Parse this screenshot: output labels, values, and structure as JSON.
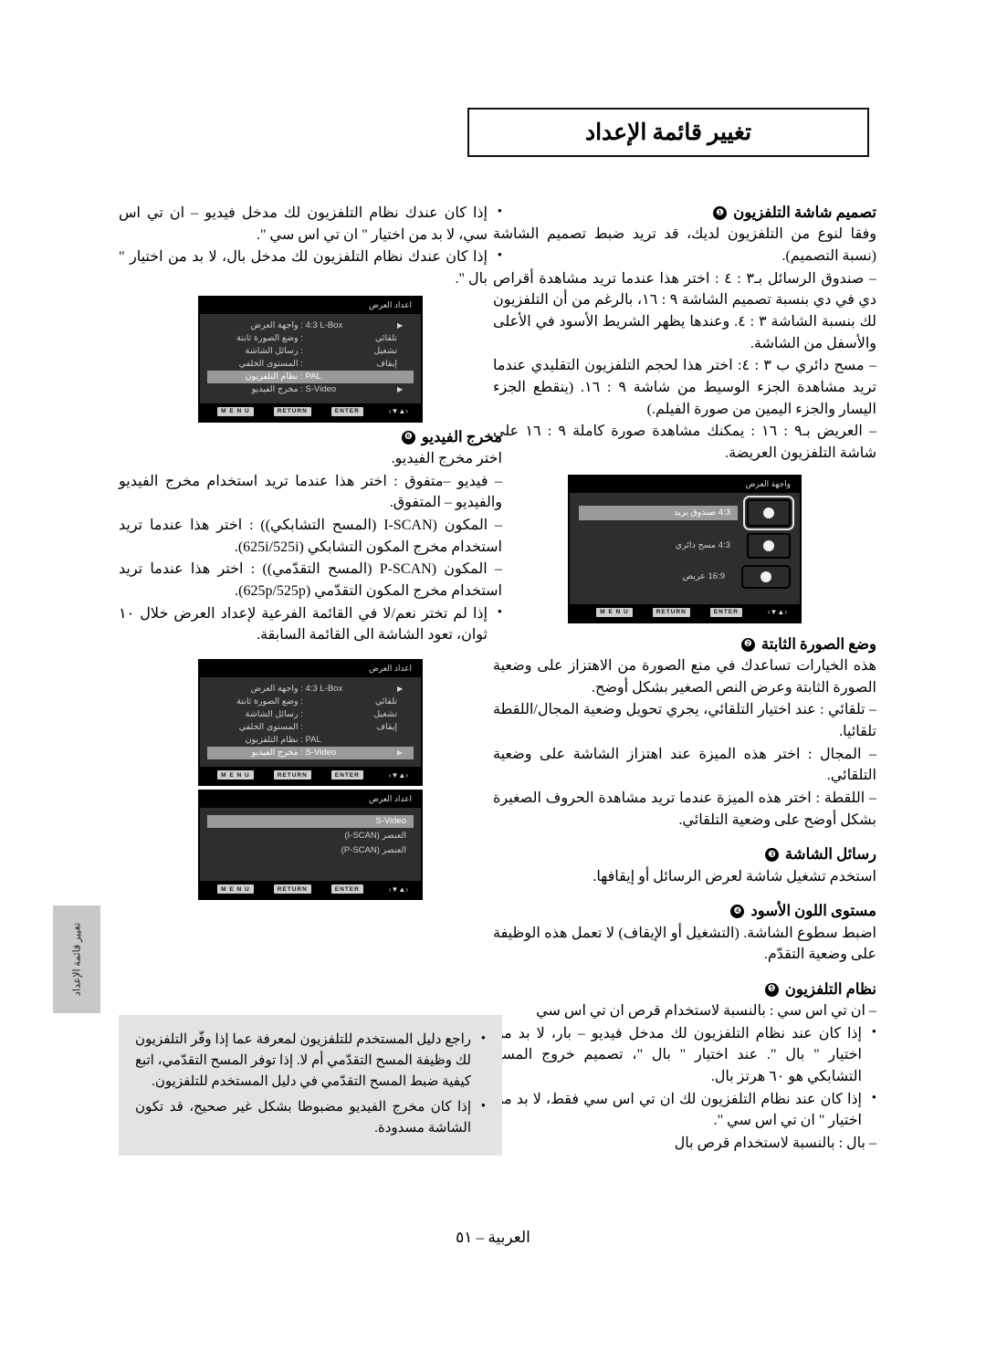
{
  "header": {
    "title": "تغيير قائمة الإعداد"
  },
  "footer": {
    "page_label": "العربية – ٥١"
  },
  "side_tab": {
    "label": "تغيير قائمة الإعداد"
  },
  "right_column": {
    "sections": [
      {
        "number": "❶",
        "title": "تصميم شاشة التلفزيون",
        "paragraphs": [
          "وفقا لنوع من التلفزيون لديك، قد تريد ضبط تصميم الشاشة (نسبة التصميم).",
          "– صندوق الرسائل بـ٣ : ٤ : اختر هذا عندما تريد مشاهدة أقراص دي في دي بنسبة تصميم الشاشة ٩ : ١٦، بالرغم من أن التلفزيون لك بنسبة الشاشة ٣ : ٤. وعندها يظهر الشريط الأسود في الأعلى والأسفل من الشاشة.",
          "– مسح دائري ب ٣ : ٤: اختر هذا لحجم التلفزيون التقليدي عندما تريد مشاهدة الجزء الوسيط من شاشة ٩ : ١٦. (ينقطع الجزء اليسار والجزء اليمين من صورة الفيلم.)",
          "– العريض بـ٩ : ١٦ : يمكنك مشاهدة صورة كاملة ٩ : ١٦ على شاشة التلفزيون العريضة."
        ]
      },
      {
        "number": "❷",
        "title": "وضع الصورة الثابتة",
        "paragraphs": [
          "هذه الخيارات تساعدك في منع الصورة من الاهتزاز على وضعية الصورة الثابتة وعرض النص الصغير بشكل أوضح.",
          "– تلقائي : عند اختيار التلقائي، يجري تحويل وضعية المجال/اللقطة تلقائيا.",
          "– المجال : اختر هذه الميزة عند اهتزاز الشاشة على وضعية التلقائي.",
          "– اللقطة : اختر هذه الميزة عندما تريد مشاهدة الحروف الصغيرة بشكل أوضح على وضعية التلقائي."
        ]
      },
      {
        "number": "❸",
        "title": "رسائل الشاشة",
        "paragraphs": [
          "استخدم تشغيل شاشة لعرض الرسائل أو إيقافها."
        ]
      },
      {
        "number": "❹",
        "title": "مستوى اللون الأسود",
        "paragraphs": [
          "اضبط سطوع الشاشة. (التشغيل أو الإيقاف) لا تعمل هذه الوظيفة على وضعية التقدّم."
        ]
      },
      {
        "number": "❺",
        "title": "نظام التلفزيون",
        "paragraphs": [
          "– ان تي اس سي : بالنسبة لاستخدام قرص ان تي اس سي"
        ],
        "bullets": [
          "إذا كان عند نظام التلفزيون لك مدخل فيديو – بار، لا بد من اختيار \" بال \". عند اختيار \" بال \"، تصميم خروج المسح التشابكي هو ٦٠ هرتز بال.",
          "إذا كان عند نظام التلفزيون لك ان تي اس سي فقط، لا بد من اختيار \" ان تي اس سي \"."
        ],
        "trailing": [
          "– بال : بالنسبة لاستخدام قرص بال"
        ]
      }
    ],
    "osd_aspect": {
      "title": "واجهة العرض",
      "options": [
        {
          "label": "4:3 صندوق بريد",
          "icon": "tv-letterbox-icon",
          "selected": true
        },
        {
          "label": "4:3 مسح دائري",
          "icon": "tv-panscan-icon",
          "selected": false
        },
        {
          "label": "16:9 عريض",
          "icon": "tv-wide-icon",
          "selected": false
        }
      ],
      "footer_keys": [
        "ENTER",
        "RETURN",
        "M E N U"
      ],
      "nav_glyph": "‹▲▼›"
    }
  },
  "left_column": {
    "top_bullets": [
      "إذا كان عندك نظام التلفزيون لك مدخل فيديو – ان تي اس سي، لا بد من اختيار \" ان تي اس سي \".",
      "إذا كان عندك نظام التلفزيون لك مدخل بال، لا بد من اختيار \" بال \"."
    ],
    "osd_setup_1": {
      "title": "اعداد العرض",
      "rows": [
        {
          "label": "واجهة العرض",
          "value": "4:3 L-Box",
          "arrow": true,
          "selected": false
        },
        {
          "label": "وضع الصورة ثابتة",
          "value": "تلقائي",
          "arabic_value": true,
          "selected": false
        },
        {
          "label": "رسائل الشاشة",
          "value": "تشغيل",
          "arabic_value": true,
          "selected": false
        },
        {
          "label": "المستوى الخلفي",
          "value": "إيقاف",
          "arabic_value": true,
          "selected": false
        },
        {
          "label": "نظام التلفزيون",
          "value": "PAL",
          "selected": true
        },
        {
          "label": "مخرج الفيديو",
          "value": "S-Video",
          "arrow": true,
          "selected": false
        }
      ],
      "footer_keys": [
        "ENTER",
        "RETURN",
        "M E N U"
      ]
    },
    "osd_setup_2": {
      "title": "اعداد العرض",
      "rows": [
        {
          "label": "واجهة العرض",
          "value": "4:3 L-Box",
          "arrow": true,
          "selected": false
        },
        {
          "label": "وضع الصورة ثابتة",
          "value": "تلقائي",
          "arabic_value": true,
          "selected": false
        },
        {
          "label": "رسائل الشاشة",
          "value": "تشغيل",
          "arabic_value": true,
          "selected": false
        },
        {
          "label": "المستوى الخلفي",
          "value": "إيقاف",
          "arabic_value": true,
          "selected": false
        },
        {
          "label": "نظام التلفزيون",
          "value": "PAL",
          "selected": false
        },
        {
          "label": "مخرج الفيديو",
          "value": "S-Video",
          "arrow": true,
          "selected": true
        }
      ],
      "footer_keys": [
        "ENTER",
        "RETURN",
        "M E N U"
      ]
    },
    "osd_video_out": {
      "title": "اعداد العرض",
      "items": [
        {
          "label": "S-Video",
          "selected": true,
          "arabic": false
        },
        {
          "label": "العنصر (I-SCAN)",
          "selected": false,
          "arabic": true
        },
        {
          "label": "العنصر (P-SCAN)",
          "selected": false,
          "arabic": true
        }
      ],
      "footer_keys": [
        "ENTER",
        "RETURN",
        "M E N U"
      ]
    },
    "section_video_out": {
      "number": "❻",
      "title": "مخرج الفيديو",
      "paragraphs": [
        "اختر مخرج الفيديو.",
        "– فيديو –متفوق : اختر هذا عندما تريد استخدام مخرج الفيديو والفيديو – المتفوق.",
        "– المكون (I-SCAN (المسح التشابكي)) : اختر هذا عندما تريد استخدام مخرج المكون التشابكي (625i/525i).",
        "– المكون (P-SCAN (المسح التقدّمي)) : اختر هذا عندما تريد استخدام مخرج المكون التقدّمي (625p/525p)."
      ],
      "bullets": [
        "إذا لم تختر نعم/لا في القائمة الفرعية لإعداد العرض خلال ١٠ ثوان، تعود الشاشة الى القائمة السابقة."
      ]
    },
    "note_box": {
      "bullets": [
        "راجع دليل المستخدم للتلفزيون لمعرفة عما إذا وفّر التلفزيون لك وظيفة المسح التقدّمي أم لا. إذا توفر المسح التقدّمي، اتبع كيفية ضبط المسح التقدّمي في دليل المستخدم للتلفزيون.",
        "إذا كان مخرج الفيديو مضبوطا بشكل غير صحيح، قد تكون الشاشة مسدودة."
      ]
    }
  }
}
